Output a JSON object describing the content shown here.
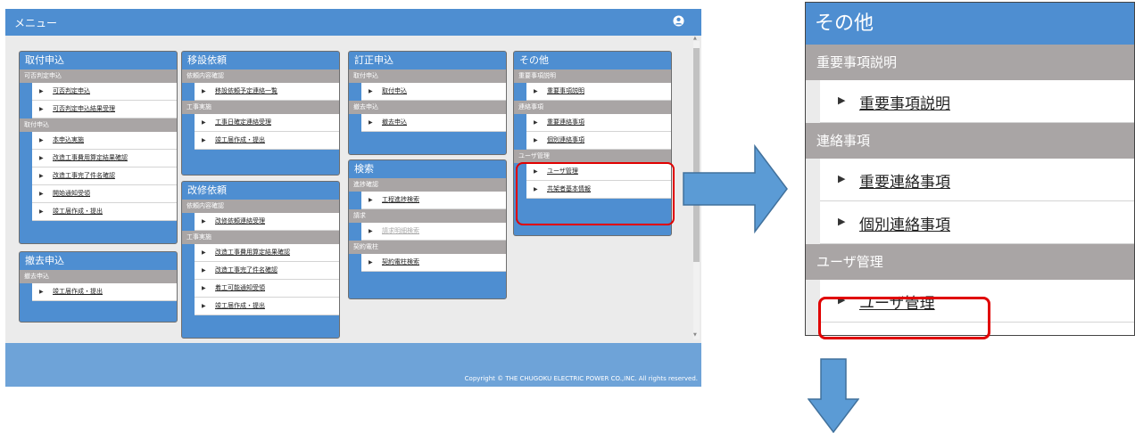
{
  "header": {
    "title": "メニュー",
    "user_icon": "user-circle-icon"
  },
  "footer": {
    "copyright": "Copyright © THE CHUGOKU ELECTRIC POWER CO.,INC. All rights reserved."
  },
  "cards": {
    "toritsuke": {
      "title": "取付申込",
      "sections": [
        {
          "label": "可否判定申込",
          "items": [
            "可否判定申込",
            "可否判定申込結果受理"
          ]
        },
        {
          "label": "取付申込",
          "items": [
            "本申込実施",
            "改造工事費用算定結果確認",
            "改造工事完了件名確認",
            "開始通知受領",
            "竣工届作成・提出"
          ]
        }
      ]
    },
    "tekkyo": {
      "title": "撤去申込",
      "sections": [
        {
          "label": "撤去申込",
          "items": [
            "竣工届作成・提出"
          ]
        }
      ]
    },
    "isetsu": {
      "title": "移設依頼",
      "sections": [
        {
          "label": "依頼内容確認",
          "items": [
            "移設依頼予定連絡一覧"
          ]
        },
        {
          "label": "工事実施",
          "items": [
            "工事日確定連絡受理",
            "竣工届作成・提出"
          ]
        }
      ]
    },
    "kaishu": {
      "title": "改修依頼",
      "sections": [
        {
          "label": "依頼内容確認",
          "items": [
            "改修依頼連絡受理"
          ]
        },
        {
          "label": "工事実施",
          "items": [
            "改造工事費用算定結果確認",
            "改造工事完了件名確認",
            "着工可能通知受領",
            "竣工届作成・提出"
          ]
        }
      ]
    },
    "teisei": {
      "title": "訂正申込",
      "sections": [
        {
          "label": "取付申込",
          "items": [
            "取付申込"
          ]
        },
        {
          "label": "撤去申込",
          "items": [
            "撤去申込"
          ]
        }
      ]
    },
    "kensaku": {
      "title": "検索",
      "sections": [
        {
          "label": "進捗確認",
          "items": [
            "工程進捗検索"
          ]
        },
        {
          "label": "請求",
          "items": [
            "請求明細検索"
          ]
        },
        {
          "label": "契約電柱",
          "items": [
            "契約電柱検索"
          ]
        }
      ]
    },
    "sonota": {
      "title": "その他",
      "sections": [
        {
          "label": "重要事項説明",
          "items": [
            "重要事項説明"
          ]
        },
        {
          "label": "連絡事項",
          "items": [
            "重要連絡事項",
            "個別連絡事項"
          ]
        },
        {
          "label": "ユーザ管理",
          "items": [
            "ユーザ管理",
            "共架者基本情報"
          ]
        }
      ]
    }
  },
  "highlight_color": "#e00000",
  "accent_color": "#4e8ed1",
  "arrow_color": "#5b9bd5"
}
